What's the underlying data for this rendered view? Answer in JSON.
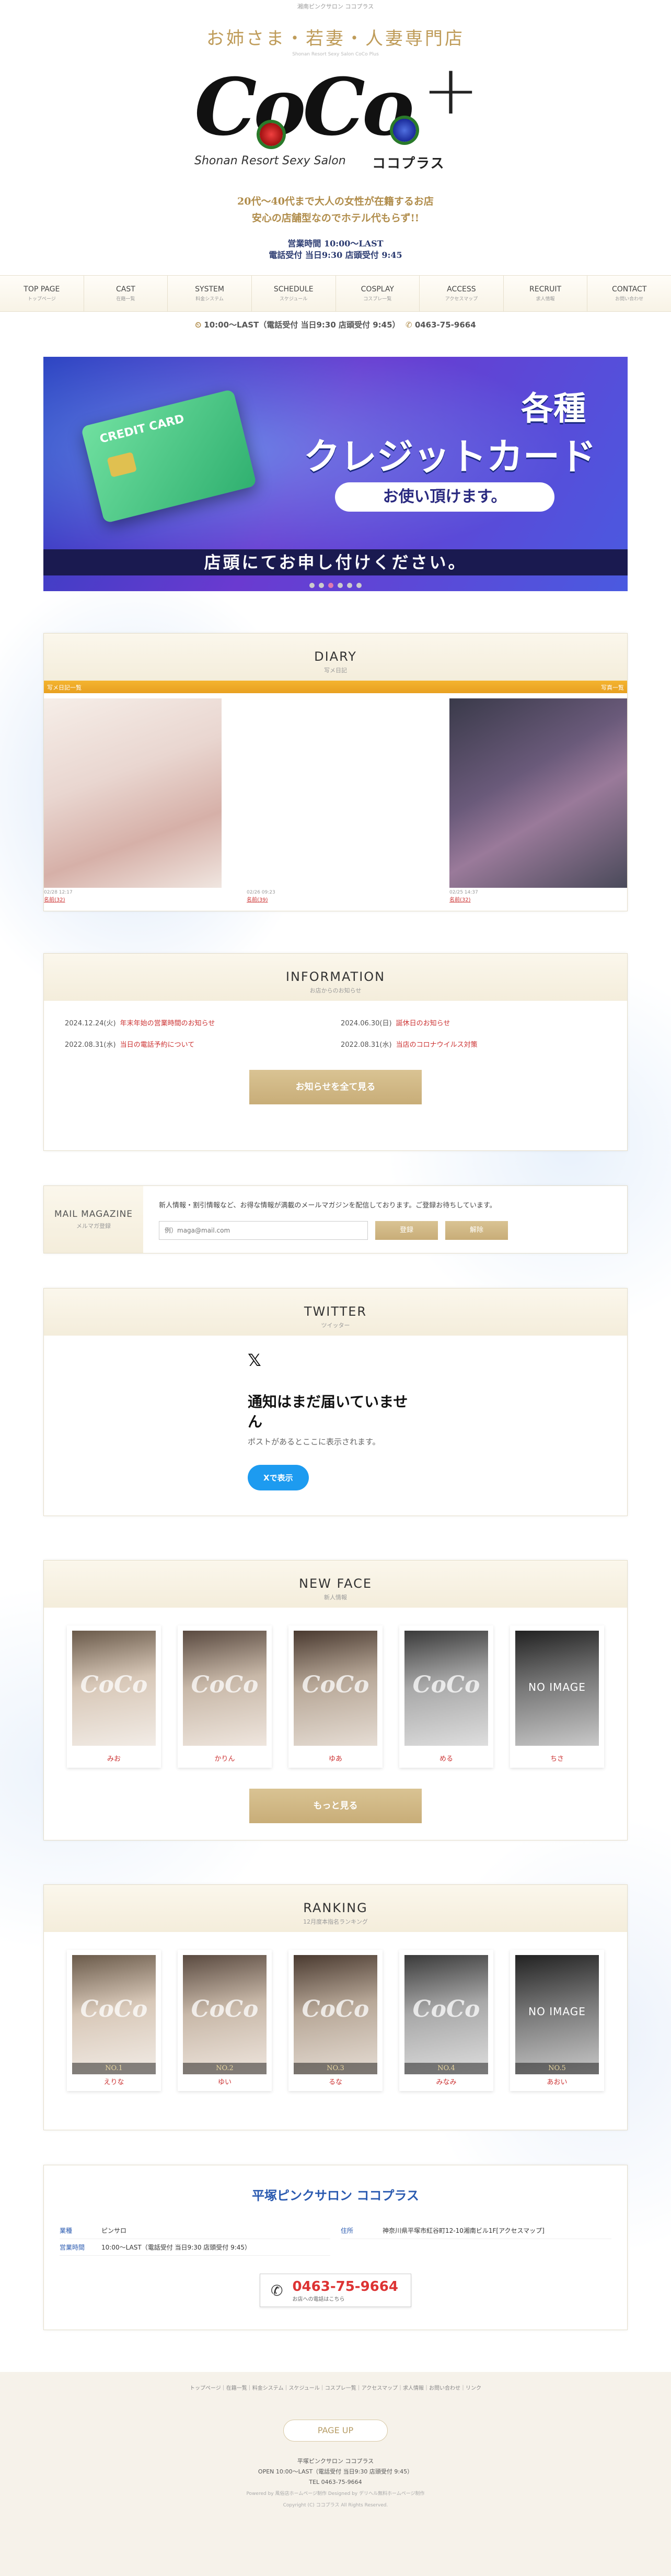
{
  "top_caption": "湘南ピンクサロン ココプラス",
  "header": {
    "tagline": "お姉さま・若妻・人妻専門店",
    "tagline_sub": "Shonan Resort Sexy Salon CoCo Plus",
    "logo": "CoCo",
    "logo_plus": "+",
    "logo_sub": "Shonan Resort Sexy Salon",
    "logo_kana": "ココプラス",
    "copy1": "20代～40代まで大人の女性が在籍するお店",
    "copy2": "安心の店舗型なのでホテル代もらず!!",
    "hours1": "営業時間 10:00～LAST",
    "hours2": "電話受付 当日9:30  店頭受付 9:45"
  },
  "nav": [
    {
      "en": "TOP PAGE",
      "jp": "トップページ"
    },
    {
      "en": "CAST",
      "jp": "在籍一覧"
    },
    {
      "en": "SYSTEM",
      "jp": "料金システム"
    },
    {
      "en": "SCHEDULE",
      "jp": "スケジュール"
    },
    {
      "en": "COSPLAY",
      "jp": "コスプレ一覧"
    },
    {
      "en": "ACCESS",
      "jp": "アクセスマップ"
    },
    {
      "en": "RECRUIT",
      "jp": "求人情報"
    },
    {
      "en": "CONTACT",
      "jp": "お問い合わせ"
    }
  ],
  "infoline": {
    "hours": "10:00～LAST（電話受付 当日9:30 店頭受付 9:45）",
    "tel": "0463-75-9664"
  },
  "banner": {
    "card_label": "CREDIT CARD",
    "t1": "各種",
    "t2": "クレジットカード",
    "pill": "お使い頂けます。",
    "bottom": "店頭にてお申し付けください。"
  },
  "diary": {
    "title": "DIARY",
    "sub": "写メ日記",
    "bar_left": "写メ日記一覧",
    "bar_right": "写真一覧",
    "items": [
      {
        "date": "02/28  12:17",
        "name": "名前(32)"
      },
      {
        "date": "02/26  09:23",
        "name": "名前(39)"
      },
      {
        "date": "02/25  14:37",
        "name": "名前(32)"
      }
    ]
  },
  "information": {
    "title": "INFORMATION",
    "sub": "お店からのお知らせ",
    "news": [
      {
        "date": "2024.12.24(火)",
        "text": "年末年始の営業時間のお知らせ"
      },
      {
        "date": "2024.06.30(日)",
        "text": "誕休日のお知らせ"
      },
      {
        "date": "2022.08.31(水)",
        "text": "当日の電話予約について"
      },
      {
        "date": "2022.08.31(水)",
        "text": "当店のコロナウイルス対策"
      }
    ],
    "button": "お知らせを全て見る"
  },
  "mail": {
    "title": "MAIL MAGAZINE",
    "sub": "メルマガ登録",
    "text": "新人情報・割引情報など、お得な情報が満載のメールマガジンを配信しております。ご登録お待ちしています。",
    "placeholder": "例）maga@mail.com",
    "register": "登録",
    "cancel": "解除"
  },
  "twitter": {
    "title": "TWITTER",
    "sub": "ツイッター",
    "logo": "𝕏",
    "heading": "通知はまだ届いていません",
    "text": "ポストがあるとここに表示されます。",
    "button": "Xで表示"
  },
  "newface": {
    "title": "NEW FACE",
    "sub": "新人情報",
    "watermark": "CoCo",
    "noimage": "NO IMAGE",
    "casts": [
      "みお",
      "かりん",
      "ゆあ",
      "める",
      "ちさ"
    ],
    "button": "もっと見る"
  },
  "ranking": {
    "title": "RANKING",
    "sub": "12月度本指名ランキング",
    "casts": [
      {
        "no": "NO.1",
        "name": "えりな"
      },
      {
        "no": "NO.2",
        "name": "ゆい"
      },
      {
        "no": "NO.3",
        "name": "るな"
      },
      {
        "no": "NO.4",
        "name": "みなみ"
      },
      {
        "no": "NO.5",
        "name": "あおい"
      }
    ]
  },
  "shop": {
    "title": "平塚ピンクサロン ココプラス",
    "type_label": "業種",
    "type": "ピンサロ",
    "hours_label": "営業時間",
    "hours": "10:00～LAST（電話受付 当日9:30 店頭受付 9:45）",
    "addr_label": "住所",
    "addr": "神奈川県平塚市紅谷町12-10湘南ビル1F[アクセスマップ]",
    "tel": "0463-75-9664",
    "tel_cap": "お店への電話はこちら"
  },
  "footer": {
    "links": "トップページ｜在籍一覧｜料金システム｜スケジュール｜コスプレ一覧｜アクセスマップ｜求人情報｜お問い合わせ｜リンク",
    "pageup": "PAGE UP",
    "name": "平塚ピンクサロン ココプラス",
    "open": "OPEN 10:00～LAST（電話受付 当日9:30 店頭受付 9:45）",
    "tel": "TEL 0463-75-9664",
    "powered": "Powered by 風俗店ホームページ制作 Designed by デリヘル無料ホームページ制作",
    "copy": "Copyright (C) ココプラス All Rights Reserved."
  }
}
